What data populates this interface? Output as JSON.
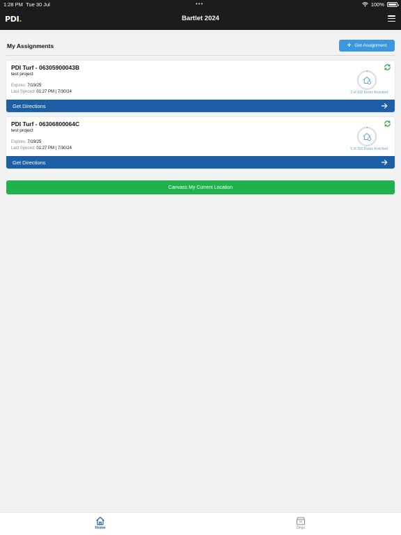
{
  "status_bar": {
    "time": "1:28 PM",
    "date": "Tue 30 Jul",
    "battery": "100%"
  },
  "header": {
    "logo": "PDI",
    "title": "Bartlet 2024",
    "menu_icon": "hamburger-menu-icon"
  },
  "main": {
    "title": "My Assignments",
    "get_assignment_label": "Get Assignment"
  },
  "assignments": [
    {
      "name": "PDI Turf - 06305900043B",
      "project": "test project",
      "expires_label": "Expires:",
      "expires": "7/19/25",
      "synced_label": "Last Synced:",
      "synced": "01:27 PM | 7/30/24",
      "knocked": "2 of 192 Doors Knocked",
      "progress": 0.0104,
      "directions_label": "Get Directions"
    },
    {
      "name": "PDI Turf - 06306800064C",
      "project": "test project",
      "expires_label": "Expires:",
      "expires": "7/19/25",
      "synced_label": "Last Synced:",
      "synced": "01:27 PM | 7/30/24",
      "knocked": "5 of 320 Doors Knocked",
      "progress": 0.0156,
      "directions_label": "Get Directions"
    }
  ],
  "canvass_label": "Canvass My Current Location",
  "tabs": [
    {
      "label": "Home",
      "icon": "home-icon",
      "active": true
    },
    {
      "label": "Orgs",
      "icon": "orgs-icon",
      "active": false
    }
  ],
  "colors": {
    "header_bg": "#1c1c1e",
    "accent_blue": "#1d5fa6",
    "button_blue": "#3a97e0",
    "canvass_green": "#20b14c",
    "sync_green": "#2eaa4a",
    "progress_orange": "#f29b1d"
  }
}
